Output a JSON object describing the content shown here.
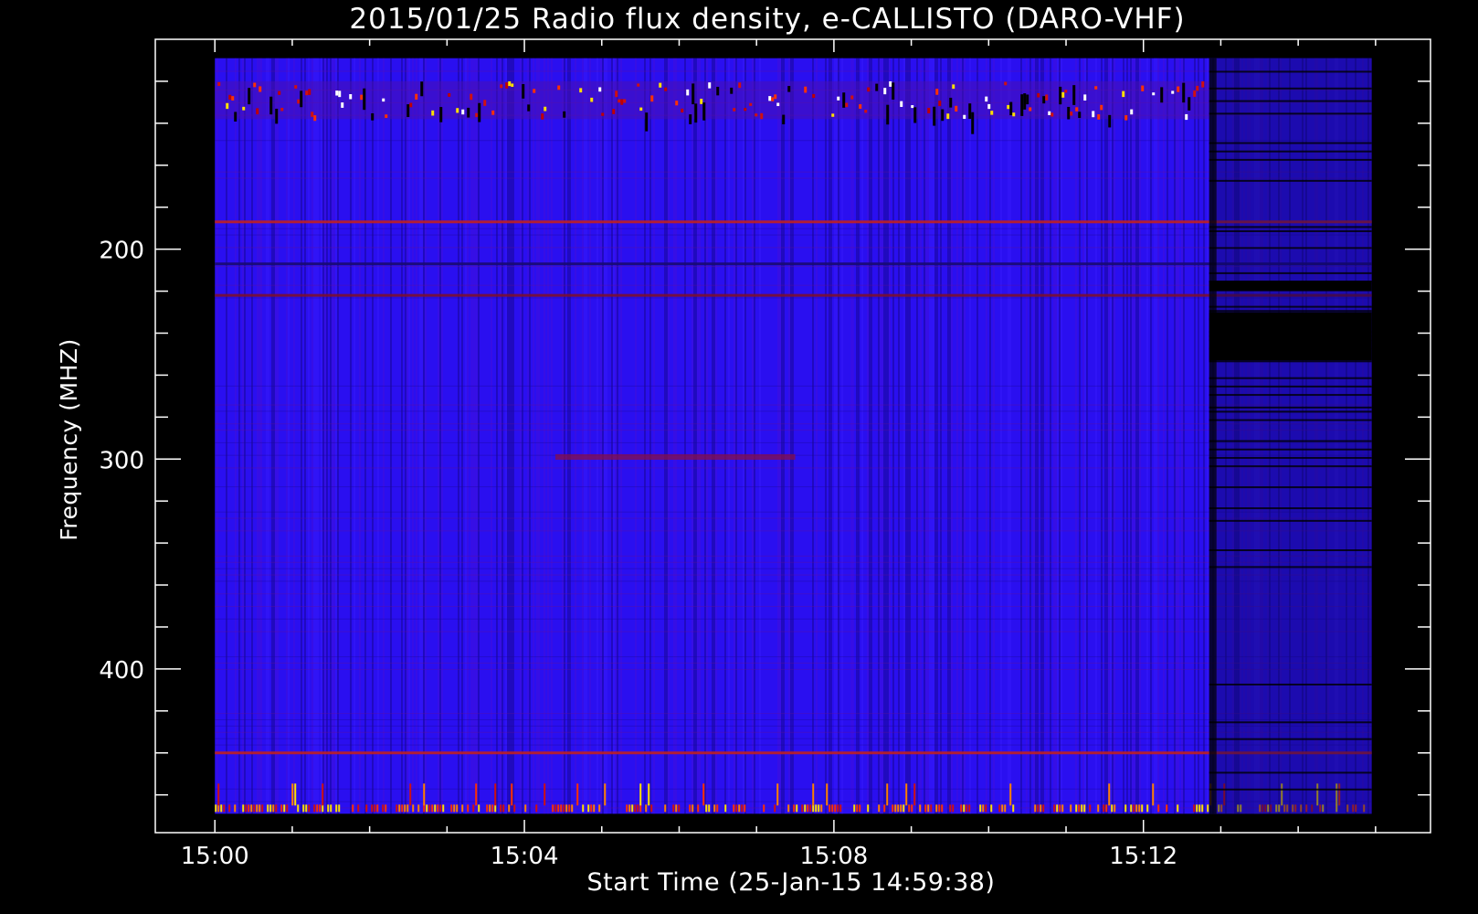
{
  "chart_data": {
    "type": "heatmap",
    "title": "2015/01/25  Radio flux density, e-CALLISTO (DARO-VHF)",
    "xlabel": "Start Time (25-Jan-15 14:59:38)",
    "ylabel": "Frequency (MHZ)",
    "x_unit": "minutes after 15:00",
    "x_range": [
      -0.77,
      15.71
    ],
    "data_x_range": [
      0.0,
      14.95
    ],
    "y_range": [
      100,
      478
    ],
    "data_y_range": [
      109,
      469
    ],
    "y_inverted": true,
    "x_ticks": [
      {
        "value": 0,
        "label": "15:00"
      },
      {
        "value": 4,
        "label": "15:04"
      },
      {
        "value": 8,
        "label": "15:08"
      },
      {
        "value": 12,
        "label": "15:12"
      }
    ],
    "y_ticks": [
      {
        "value": 200,
        "label": "200"
      },
      {
        "value": 300,
        "label": "300"
      },
      {
        "value": 400,
        "label": "400"
      }
    ],
    "colormap": [
      "#000000",
      "#1f0080",
      "#2800ff",
      "#c00000",
      "#ff3000",
      "#ffe000",
      "#ffffff"
    ],
    "background_level": "blue",
    "features": [
      {
        "kind": "interference-band",
        "freq_range": [
          120,
          138
        ],
        "time_range": [
          0.0,
          12.85
        ],
        "intensity": "high, intermittent red/yellow/white with black dropouts"
      },
      {
        "kind": "steady-line",
        "freq": 187,
        "intensity": "medium red"
      },
      {
        "kind": "steady-line",
        "freq": 207,
        "intensity": "dark"
      },
      {
        "kind": "steady-line",
        "freq": 222,
        "intensity": "dark red"
      },
      {
        "kind": "faint-band",
        "freq": 299,
        "time_range": [
          4.4,
          7.5
        ],
        "intensity": "dark red"
      },
      {
        "kind": "steady-line",
        "freq": 440,
        "intensity": "red, partially dark"
      },
      {
        "kind": "spiky-band",
        "freq_range": [
          452,
          469
        ],
        "intensity": "bright orange/yellow spikes"
      },
      {
        "kind": "low-signal-block",
        "time_range": [
          12.85,
          14.95
        ],
        "freq_range": [
          109,
          469
        ],
        "intensity": "darker blue, black horizontal bands"
      },
      {
        "kind": "gap",
        "time_range": [
          12.85,
          14.95
        ],
        "freq_range": [
          215,
          220
        ],
        "intensity": "black"
      },
      {
        "kind": "gap",
        "time_range": [
          12.85,
          14.95
        ],
        "freq_range": [
          230,
          253
        ],
        "intensity": "black"
      }
    ]
  }
}
